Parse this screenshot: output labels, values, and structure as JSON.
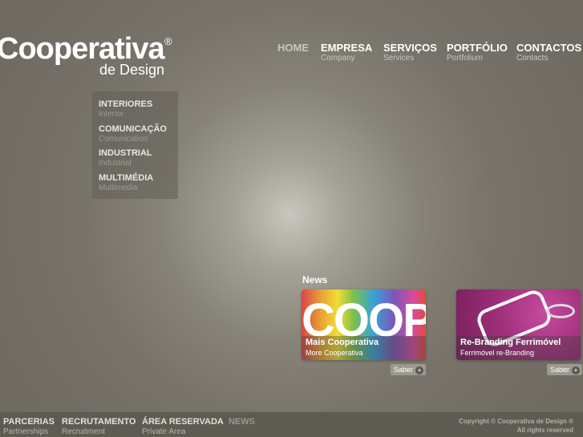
{
  "logo": {
    "name": "Cooperativa",
    "registered": "®",
    "sub": "de Design"
  },
  "nav": [
    {
      "label": "HOME",
      "en": ""
    },
    {
      "label": "EMPRESA",
      "en": "Company"
    },
    {
      "label": "SERVIÇOS",
      "en": "Services"
    },
    {
      "label": "PORTFÓLIO",
      "en": "Portfolium"
    },
    {
      "label": "CONTACTOS",
      "en": "Contacts"
    }
  ],
  "submenu": [
    {
      "label": "INTERIORES",
      "en": "Interior"
    },
    {
      "label": "COMUNICAÇÃO",
      "en": "Comunication"
    },
    {
      "label": "INDUSTRIAL",
      "en": "Industrial"
    },
    {
      "label": "MULTIMÉDIA",
      "en": "Multimedia"
    }
  ],
  "news": {
    "title": "News",
    "items": [
      {
        "image_text": "COOP",
        "title": "Mais Cooperativa",
        "subtitle": "More Cooperativa",
        "more": "Saber",
        "plus": "+"
      },
      {
        "title": "Re-Branding Ferrimóvel",
        "subtitle": "Ferrimóvel re-Branding",
        "more": "Saber",
        "plus": "+"
      }
    ]
  },
  "footer": {
    "items": [
      {
        "label": "PARCERIAS",
        "en": "Partnerships"
      },
      {
        "label": "RECRUTAMENTO",
        "en": "Recruitment"
      },
      {
        "label": "ÁREA RESERVADA",
        "en": "Private Area"
      },
      {
        "label": "NEWS",
        "en": ""
      }
    ],
    "copyright": "Copyright © Cooperativa de Design ®",
    "rights": "All rights reserved"
  }
}
